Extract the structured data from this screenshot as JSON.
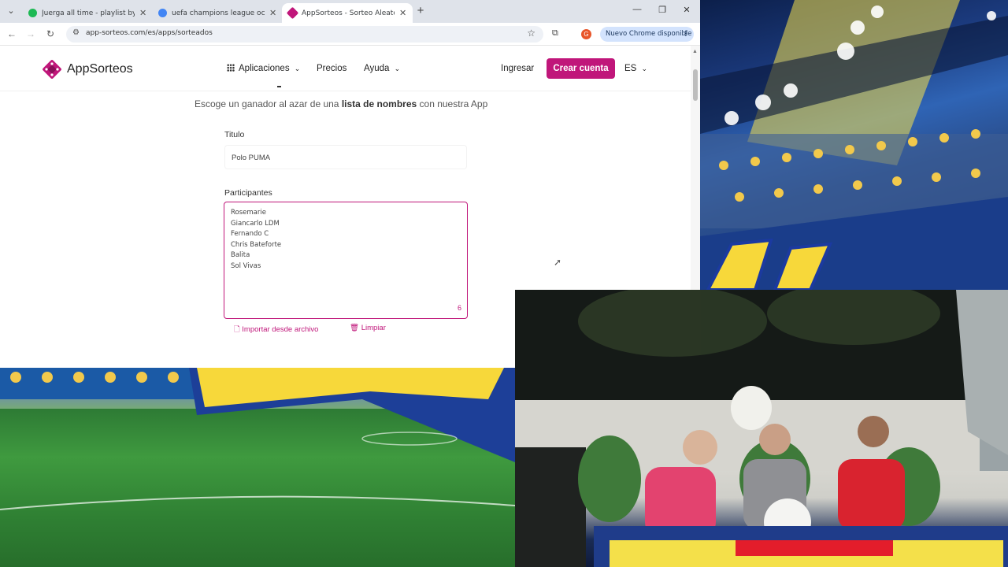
{
  "browser": {
    "tabs": [
      {
        "title": "Juerga all time - playlist by go",
        "favicon_color": "#1db954",
        "active": false
      },
      {
        "title": "uefa champions league octavos",
        "favicon_color": "#4285f4",
        "active": false
      },
      {
        "title": "AppSorteos - Sorteo Aleatorio",
        "favicon_color": "#c0167a",
        "active": true
      }
    ],
    "url": "app-sorteos.com/es/apps/sorteados",
    "profile_initial": "G",
    "update_pill": "Nuevo Chrome disponible"
  },
  "site": {
    "logo_text": "AppSorteos",
    "nav": {
      "apps": "Aplicaciones",
      "pricing": "Precios",
      "help": "Ayuda"
    },
    "login": "Ingresar",
    "signup": "Crear cuenta",
    "lang": "ES",
    "brand_color": "#c0167a"
  },
  "form": {
    "subtitle_pre": "Escoge un ganador al azar de una",
    "subtitle_bold": "lista de nombres",
    "subtitle_post": "con nuestra App",
    "title_label": "Titulo",
    "title_value": "Polo PUMA",
    "participants_label": "Participantes",
    "participants": [
      "Rosemarie",
      "Giancarlo LDM",
      "Fernando C",
      "Chris Bateforte",
      "Balita",
      "Sol Vivas"
    ],
    "participant_count": "6",
    "import_label": "Importar desde archivo",
    "clear_label": "Limpiar"
  }
}
